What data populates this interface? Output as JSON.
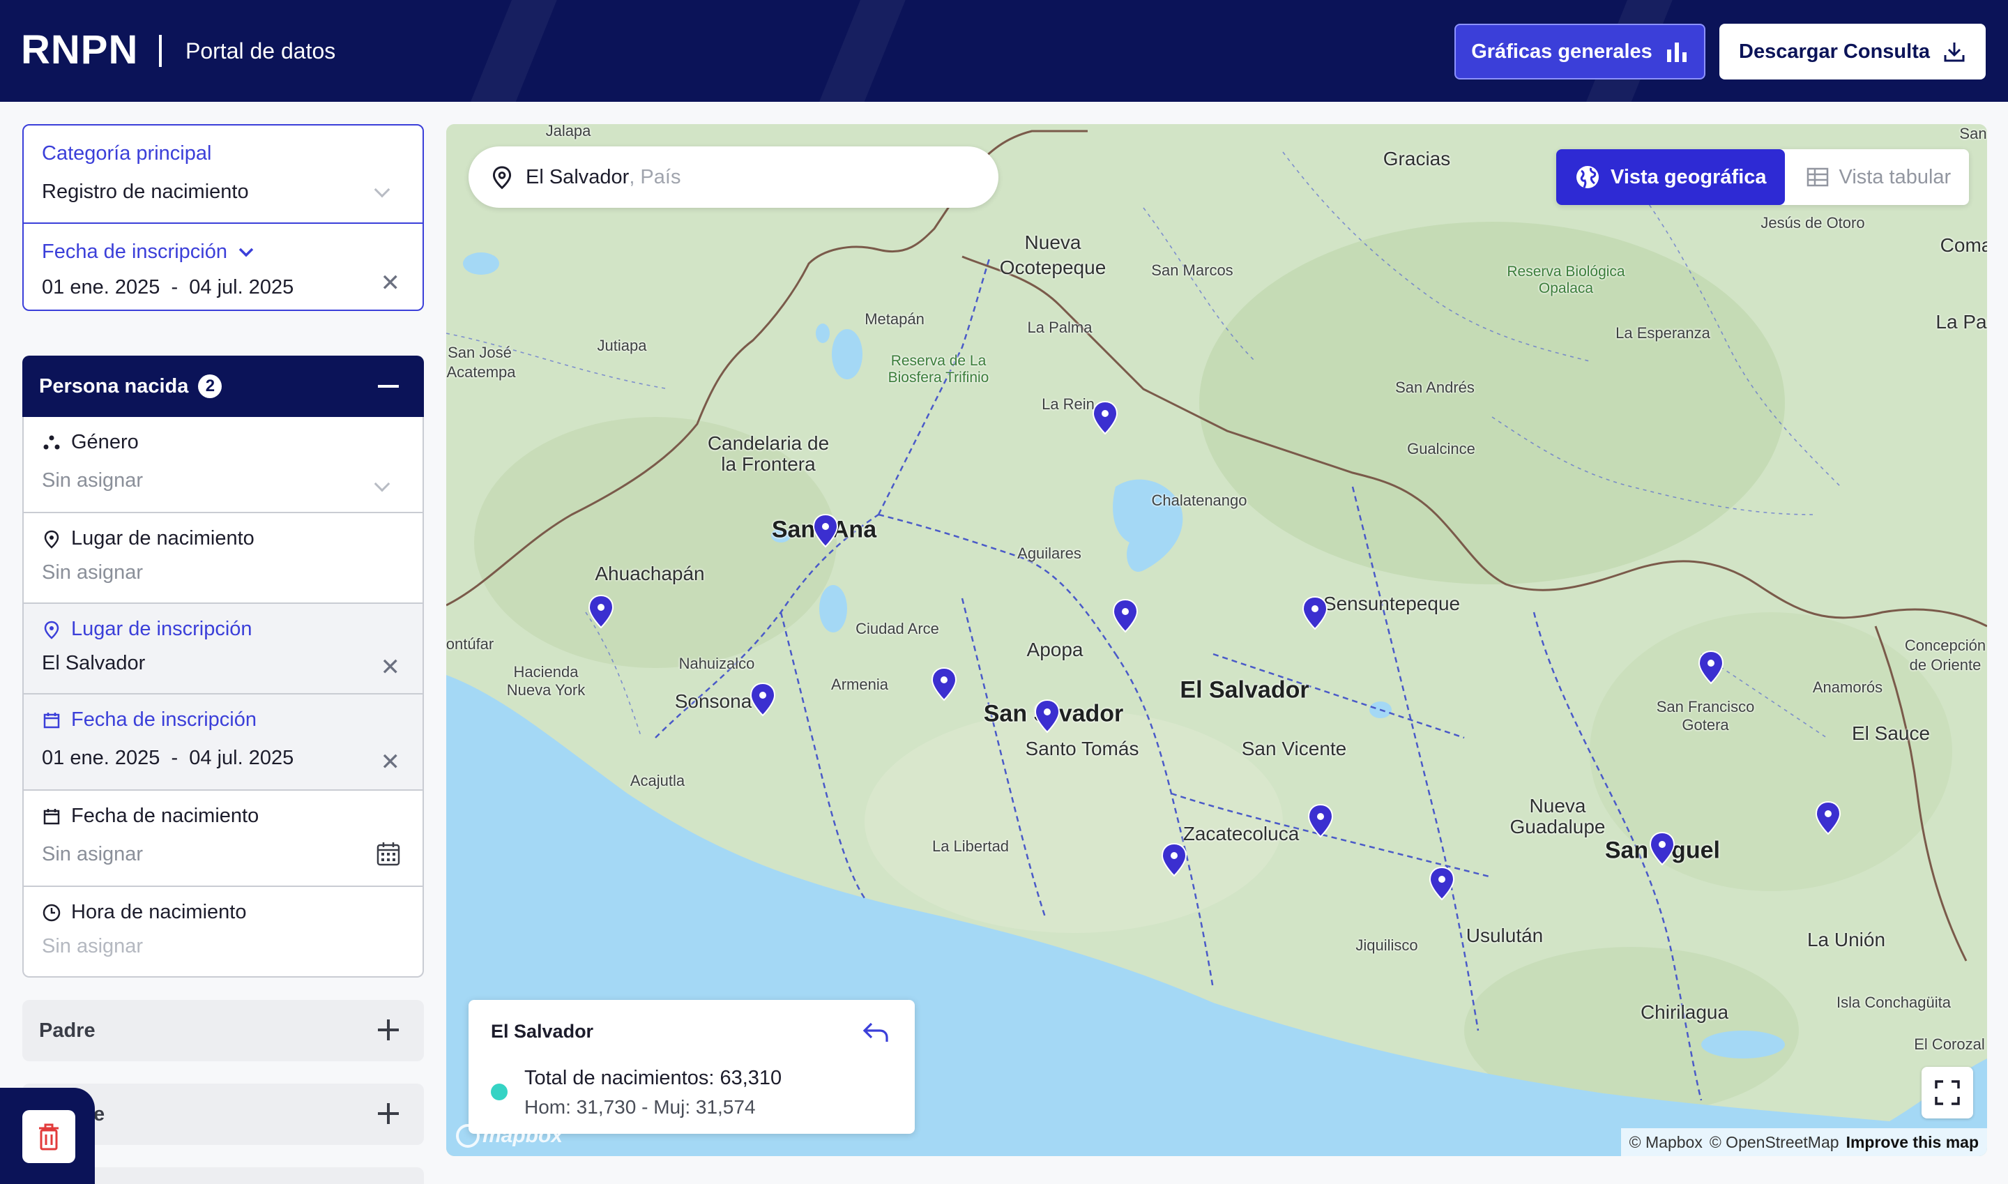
{
  "header": {
    "logo": "RNPN",
    "portal_title": "Portal de datos",
    "graficas_button": "Gráficas generales",
    "descargar_button": "Descargar Consulta"
  },
  "category_card": {
    "category_label": "Categoría principal",
    "category_value": "Registro de nacimiento",
    "date_label": "Fecha de inscripción",
    "date_start": "01 ene. 2025",
    "date_sep": "-",
    "date_end": "04 jul. 2025"
  },
  "persona_section": {
    "title": "Persona nacida",
    "badge_count": "2",
    "filters": [
      {
        "label": "Género",
        "value": "Sin asignar",
        "icon": "gender-dots-icon",
        "active": false
      },
      {
        "label": "Lugar de nacimiento",
        "value": "Sin asignar",
        "icon": "location-pin-icon",
        "active": false
      },
      {
        "label": "Lugar de inscripción",
        "value": "El Salvador",
        "icon": "location-pin-icon",
        "active": true
      },
      {
        "label": "Fecha de inscripción",
        "value_start": "01 ene. 2025",
        "value_sep": "-",
        "value_end": "04 jul. 2025",
        "icon": "calendar-icon",
        "active": true
      },
      {
        "label": "Fecha de nacimiento",
        "value": "Sin asignar",
        "icon": "calendar-icon",
        "active": false
      },
      {
        "label": "Hora de nacimiento",
        "value": "Sin asignar",
        "icon": "clock-icon",
        "active": false
      }
    ]
  },
  "collapsed_sections": [
    {
      "label": "Padre"
    },
    {
      "label": "e"
    }
  ],
  "map": {
    "search_value": "El Salvador",
    "search_suffix": ", País",
    "view_geo": "Vista geográfica",
    "view_table": "Vista tabular",
    "info_title": "El Salvador",
    "info_total": "Total de nacimientos: 63,310",
    "info_sub": "Hom: 31,730 - Muj: 31,574",
    "attribution_mapbox": "© Mapbox",
    "attribution_osm": "© OpenStreetMap",
    "attribution_improve": "Improve this map",
    "mapbox_logo": "mapbox",
    "places": [
      {
        "name": "Jalapa",
        "cls": "sm"
      },
      {
        "name": "Gracias",
        "cls": "mid"
      },
      {
        "name": "San",
        "cls": "sm"
      },
      {
        "name": "Nueva",
        "cls": "mid"
      },
      {
        "name": "Ocotepeque",
        "cls": "mid"
      },
      {
        "name": "San Marcos",
        "cls": "sm"
      },
      {
        "name": "Jesús de Otoro",
        "cls": "sm"
      },
      {
        "name": "Coma",
        "cls": "mid"
      },
      {
        "name": "Metapán",
        "cls": "sm"
      },
      {
        "name": "La Palma",
        "cls": "sm"
      },
      {
        "name": "La Esperanza",
        "cls": "sm"
      },
      {
        "name": "La Paz",
        "cls": "mid"
      },
      {
        "name": "Jutiapa",
        "cls": "sm"
      },
      {
        "name": "San José",
        "cls": "sm"
      },
      {
        "name": "Acatempa",
        "cls": "sm"
      },
      {
        "name": "San Andrés",
        "cls": "sm"
      },
      {
        "name": "La Rein",
        "cls": "sm"
      },
      {
        "name": "Candelaria de",
        "cls": "mid"
      },
      {
        "name": "la Frontera",
        "cls": "mid"
      },
      {
        "name": "Gualcince",
        "cls": "sm"
      },
      {
        "name": "Chalatenango",
        "cls": "sm"
      },
      {
        "name": "San",
        "cls": "big"
      },
      {
        "name": "Ana",
        "cls": "big"
      },
      {
        "name": "Aguilares",
        "cls": "sm"
      },
      {
        "name": "Ahuachapán",
        "cls": "mid"
      },
      {
        "name": "Sensuntepeque",
        "cls": "mid"
      },
      {
        "name": "Ciudad Arce",
        "cls": "sm"
      },
      {
        "name": "ontúfar",
        "cls": "sm"
      },
      {
        "name": "Concepción",
        "cls": "sm"
      },
      {
        "name": "de Oriente",
        "cls": "sm"
      },
      {
        "name": "Apopa",
        "cls": "mid"
      },
      {
        "name": "Hacienda",
        "cls": "sm"
      },
      {
        "name": "Nueva York",
        "cls": "sm"
      },
      {
        "name": "Nahuizalco",
        "cls": "sm"
      },
      {
        "name": "El Salvador",
        "cls": "big"
      },
      {
        "name": "Armenia",
        "cls": "sm"
      },
      {
        "name": "Anamorós",
        "cls": "sm"
      },
      {
        "name": "Sonsona",
        "cls": "mid"
      },
      {
        "name": "San S",
        "cls": "big"
      },
      {
        "name": "vador",
        "cls": "big"
      },
      {
        "name": "San Francisco",
        "cls": "sm"
      },
      {
        "name": "Gotera",
        "cls": "sm"
      },
      {
        "name": "El Sauce",
        "cls": "mid"
      },
      {
        "name": "Santo Tomás",
        "cls": "mid"
      },
      {
        "name": "San Vicente",
        "cls": "mid"
      },
      {
        "name": "Acajutla",
        "cls": "sm"
      },
      {
        "name": "Nueva",
        "cls": "mid"
      },
      {
        "name": "Guadalupe",
        "cls": "mid"
      },
      {
        "name": "Zacatecoluca",
        "cls": "mid"
      },
      {
        "name": "La Libertad",
        "cls": "sm"
      },
      {
        "name": "San",
        "cls": "big"
      },
      {
        "name": "guel",
        "cls": "big"
      },
      {
        "name": "Usulután",
        "cls": "mid"
      },
      {
        "name": "Jiquilisco",
        "cls": "sm"
      },
      {
        "name": "La Unión",
        "cls": "mid"
      },
      {
        "name": "Isla Conchagüita",
        "cls": "sm"
      },
      {
        "name": "Chirilagua",
        "cls": "mid"
      },
      {
        "name": "El Corozal",
        "cls": "sm"
      },
      {
        "name": "Reserva Biológica Opalaca",
        "cls": "green"
      },
      {
        "name": "Reserva de La Biosfera Trifinio",
        "cls": "green"
      }
    ]
  },
  "colors": {
    "navy": "#0b1358",
    "accent": "#3b3fd9",
    "pin": "#3b2fd0",
    "info_dot": "#35d3c4"
  }
}
